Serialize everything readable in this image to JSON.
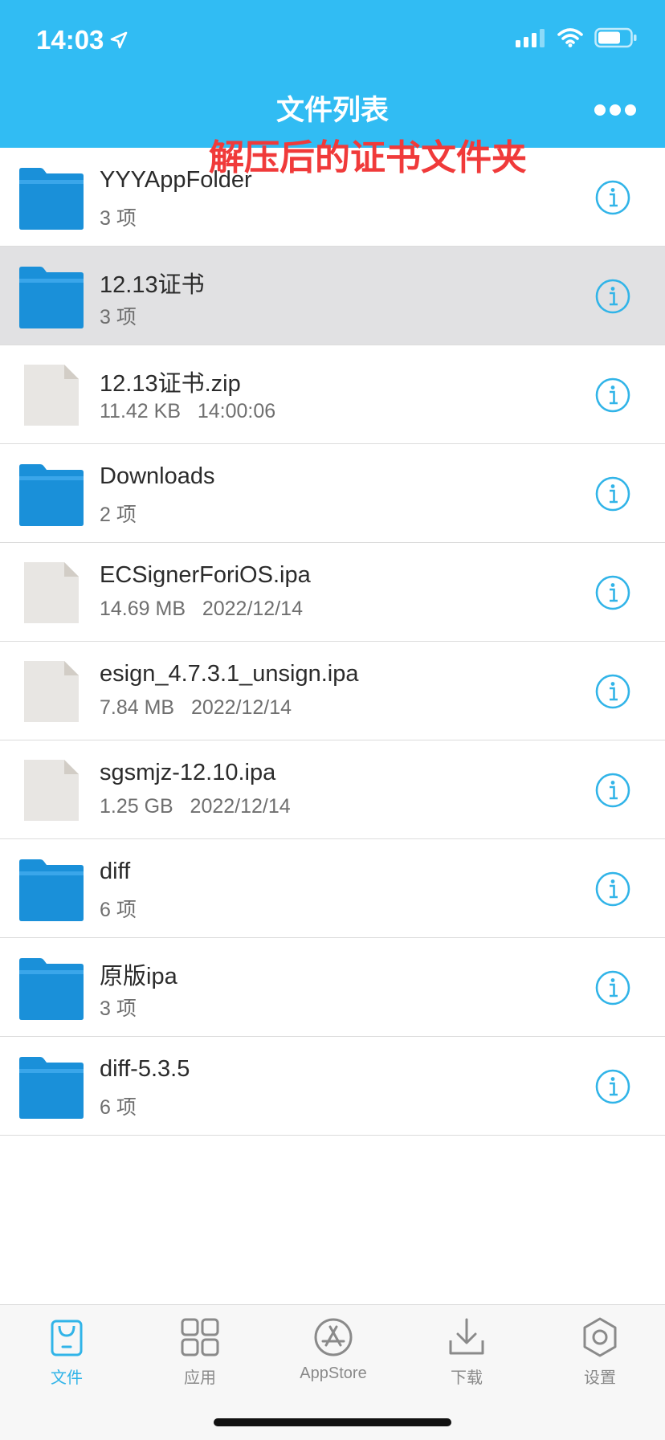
{
  "status_bar": {
    "time": "14:03"
  },
  "header": {
    "title": "文件列表"
  },
  "files": [
    {
      "name": "YYYAppFolder",
      "meta": "3 项",
      "type": "folder"
    },
    {
      "name": "12.13证书",
      "meta": "3 项",
      "type": "folder"
    },
    {
      "name": "12.13证书.zip",
      "meta": "11.42 KB   14:00:06",
      "type": "file"
    },
    {
      "name": "Downloads",
      "meta": "2 项",
      "type": "folder"
    },
    {
      "name": "ECSignerForiOS.ipa",
      "meta": "14.69 MB   2022/12/14",
      "type": "file"
    },
    {
      "name": "esign_4.7.3.1_unsign.ipa",
      "meta": "7.84 MB   2022/12/14",
      "type": "file"
    },
    {
      "name": "sgsmjz-12.10.ipa",
      "meta": "1.25 GB   2022/12/14",
      "type": "file"
    },
    {
      "name": "diff",
      "meta": "6 项",
      "type": "folder"
    },
    {
      "name": "原版ipa",
      "meta": "3 项",
      "type": "folder"
    },
    {
      "name": "diff-5.3.5",
      "meta": "6 项",
      "type": "folder"
    }
  ],
  "annotation": "解压后的证书文件夹",
  "tabs": [
    {
      "label": "文件",
      "icon": "bag-icon",
      "active": true
    },
    {
      "label": "应用",
      "icon": "grid-icon",
      "active": false
    },
    {
      "label": "AppStore",
      "icon": "appstore-icon",
      "active": false
    },
    {
      "label": "下载",
      "icon": "download-icon",
      "active": false
    },
    {
      "label": "设置",
      "icon": "gear-icon",
      "active": false
    }
  ],
  "colors": {
    "accent": "#31bcf3",
    "folder": "#1a90d9",
    "file": "#e8e6e3",
    "annotation": "#f03a3a"
  }
}
